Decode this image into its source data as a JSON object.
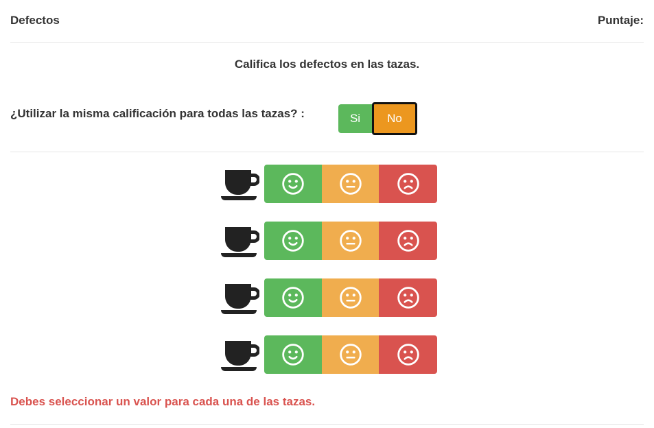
{
  "header": {
    "left_title": "Defectos",
    "right_title": "Puntaje:"
  },
  "instruction": "Califica los defectos en las tazas.",
  "same_rating_question": "¿Utilizar la misma calificación para todas las tazas? :",
  "toggle": {
    "yes_label": "Si",
    "no_label": "No",
    "selected": "No"
  },
  "cups": [
    {
      "icon": "coffee-cup-icon",
      "options": [
        "good-face-icon",
        "neutral-face-icon",
        "bad-face-icon"
      ]
    },
    {
      "icon": "coffee-cup-icon",
      "options": [
        "good-face-icon",
        "neutral-face-icon",
        "bad-face-icon"
      ]
    },
    {
      "icon": "coffee-cup-icon",
      "options": [
        "good-face-icon",
        "neutral-face-icon",
        "bad-face-icon"
      ]
    },
    {
      "icon": "coffee-cup-icon",
      "options": [
        "good-face-icon",
        "neutral-face-icon",
        "bad-face-icon"
      ]
    }
  ],
  "colors": {
    "good": "#5cb85c",
    "neutral": "#f0ad4e",
    "bad": "#d9534f",
    "selected_toggle": "#ec971f",
    "error": "#d9534f"
  },
  "error_message": "Debes seleccionar un valor para cada una de las tazas."
}
